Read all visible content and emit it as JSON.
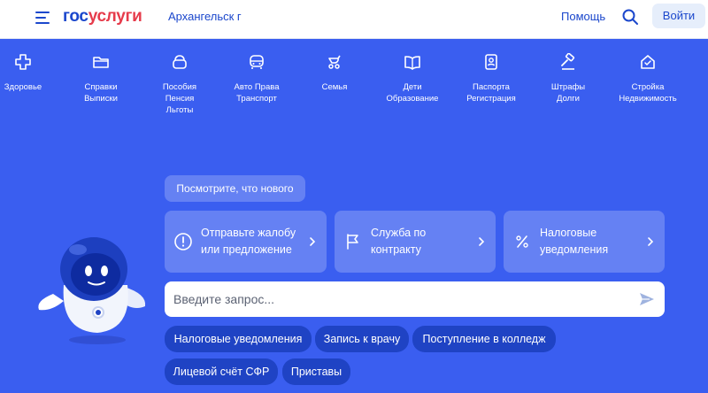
{
  "header": {
    "logo_part1": "гос",
    "logo_part2": "услуги",
    "city": "Архангельск г",
    "help": "Помощь",
    "login": "Войти",
    "icons": [
      "menu-icon",
      "search-icon"
    ]
  },
  "categories": [
    {
      "label": "Здоровье",
      "icon": "cross-icon"
    },
    {
      "label": "Справки Выписки",
      "icon": "folder-icon"
    },
    {
      "label": "Пособия Пенсия Льготы",
      "icon": "wallet-icon"
    },
    {
      "label": "Авто Права Транспорт",
      "icon": "car-icon"
    },
    {
      "label": "Семья",
      "icon": "stroller-icon"
    },
    {
      "label": "Дети Образование",
      "icon": "book-icon"
    },
    {
      "label": "Паспорта Регистрация",
      "icon": "passport-icon"
    },
    {
      "label": "Штрафы Долги",
      "icon": "gavel-icon"
    },
    {
      "label": "Стройка Недвижимость",
      "icon": "house-icon"
    }
  ],
  "assistant": {
    "whats_new": "Посмотрите, что нового",
    "cards": [
      {
        "label": "Отправьте жалобу или предложение",
        "icon": "alert-circle-icon"
      },
      {
        "label": "Служба по контракту",
        "icon": "flag-icon"
      },
      {
        "label": "Налоговые уведомления",
        "icon": "percent-icon"
      }
    ],
    "search_placeholder": "Введите запрос...",
    "chips": [
      "Налоговые уведомления",
      "Запись к врачу",
      "Поступление в колледж",
      "Лицевой счёт СФР",
      "Приставы"
    ]
  },
  "colors": {
    "brand_blue": "#1b47cc",
    "brand_red": "#e63b4b",
    "background": "#3a5ef0",
    "chip": "#1f43c4"
  }
}
